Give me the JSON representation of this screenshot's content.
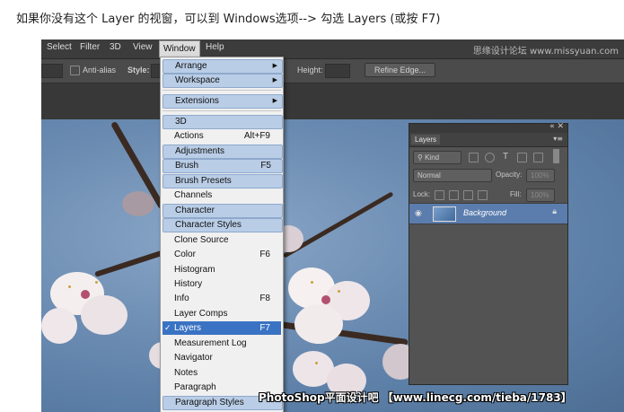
{
  "caption": "如果你没有这个 Layer 的视窗，可以到 Windows选项--> 勾选 Layers (或按 F7)",
  "menubar": {
    "items": [
      "Select",
      "Filter",
      "3D",
      "View",
      "Window",
      "Help"
    ],
    "active": "Window",
    "watermark": "思缘设计论坛 www.missyuan.com"
  },
  "options_bar": {
    "antialias": "Anti-alias",
    "style_label": "Style:",
    "height_label": "Height:",
    "refine_edge": "Refine Edge..."
  },
  "window_menu": {
    "items": [
      {
        "label": "Arrange",
        "submenu": true,
        "highlight": true
      },
      {
        "label": "Workspace",
        "submenu": true,
        "highlight": true
      },
      {
        "label": "Extensions",
        "submenu": true,
        "highlight": true
      },
      {
        "label": "3D",
        "highlight": true
      },
      {
        "label": "Actions",
        "shortcut": "Alt+F9"
      },
      {
        "label": "Adjustments",
        "highlight": true
      },
      {
        "label": "Brush",
        "shortcut": "F5",
        "highlight": true
      },
      {
        "label": "Brush Presets",
        "highlight": true
      },
      {
        "label": "Channels"
      },
      {
        "label": "Character",
        "highlight": true
      },
      {
        "label": "Character Styles",
        "highlight": true
      },
      {
        "label": "Clone Source"
      },
      {
        "label": "Color",
        "shortcut": "F6"
      },
      {
        "label": "Histogram"
      },
      {
        "label": "History"
      },
      {
        "label": "Info",
        "shortcut": "F8"
      },
      {
        "label": "Layer Comps"
      },
      {
        "label": "Layers",
        "shortcut": "F7",
        "checked": true,
        "selected": true
      },
      {
        "label": "Measurement Log"
      },
      {
        "label": "Navigator"
      },
      {
        "label": "Notes"
      },
      {
        "label": "Paragraph"
      },
      {
        "label": "Paragraph Styles",
        "highlight": true
      }
    ],
    "check_mark": "✓",
    "submenu_arrow": "▶"
  },
  "layers_panel": {
    "tab": "Layers",
    "kind_label": "Kind",
    "blend_mode": "Normal",
    "opacity_label": "Opacity:",
    "opacity_value": "100%",
    "lock_label": "Lock:",
    "fill_label": "Fill:",
    "fill_value": "100%",
    "layer_name": "Background"
  },
  "footer": "PhotoShop平面设计吧 【www.linecg.com/tieba/1783】",
  "colors": {
    "menu_highlight": "#b9cde6",
    "menu_selected": "#3a73c3",
    "layer_selected": "#5b7dae",
    "app_bg": "#535353"
  }
}
